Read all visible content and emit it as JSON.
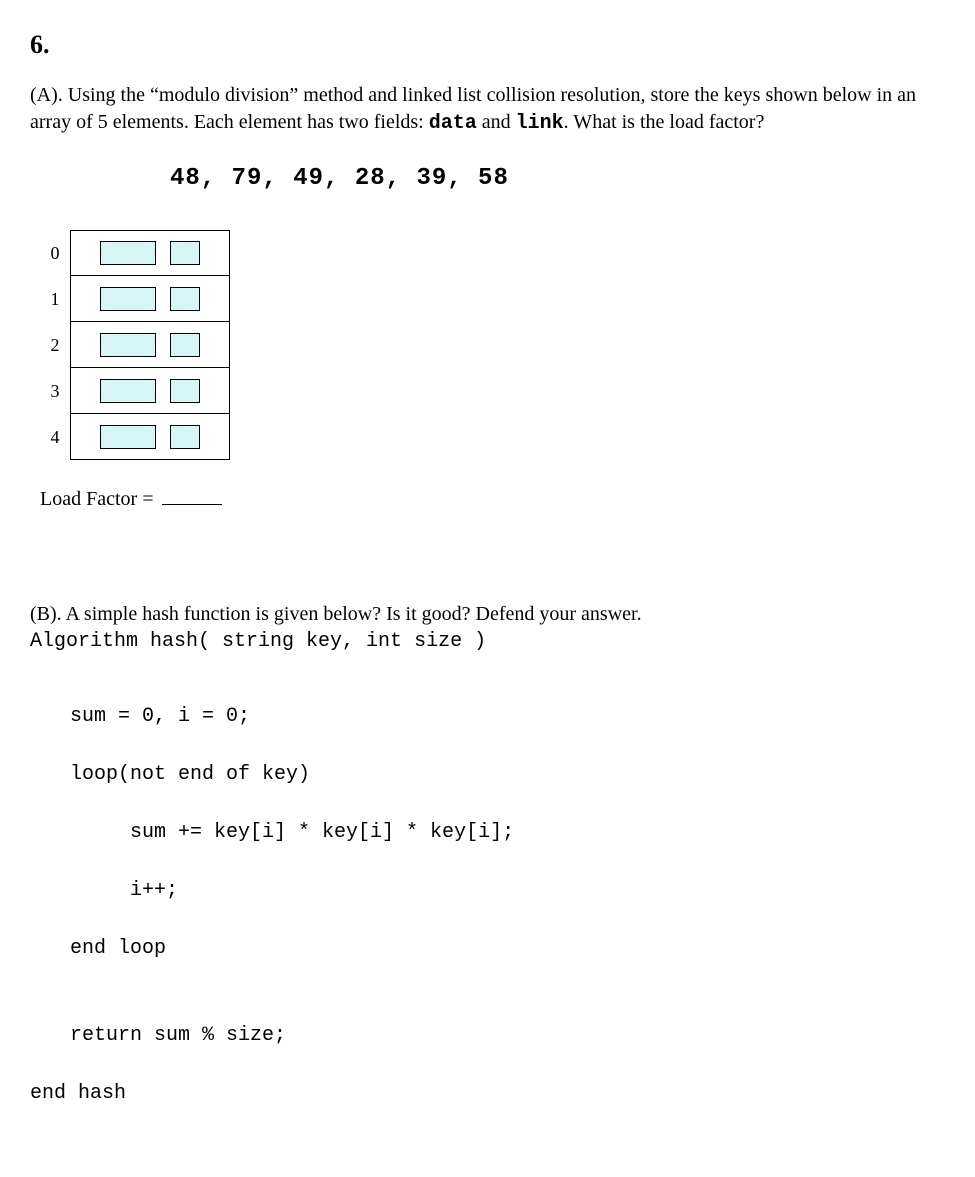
{
  "question_number": "6.",
  "partA": {
    "label": "(A).",
    "text_before_data": " Using the “modulo division” method and linked list collision resolution, store the keys shown below in an array of 5 elements. Each element has two fields: ",
    "field1": "data",
    "and_word": " and ",
    "field2": "link",
    "text_after_link": ". What is the load factor?",
    "keys": "48, 79, 49, 28, 39, 58",
    "indices": [
      "0",
      "1",
      "2",
      "3",
      "4"
    ],
    "load_factor_label": "Load Factor ="
  },
  "partB": {
    "label": "(B).",
    "text": " A simple hash function is given below? Is it good? Defend your answer.",
    "algline": "Algorithm hash( string key, int size )",
    "code_sum": "sum = 0, i = 0;",
    "code_loop": "loop(not end of key)",
    "code_body1": "     sum += key[i] * key[i] * key[i];",
    "code_body2": "     i++;",
    "code_end": "end loop",
    "code_blank": "",
    "code_return": "return sum % size;",
    "code_endhash": "end hash"
  }
}
